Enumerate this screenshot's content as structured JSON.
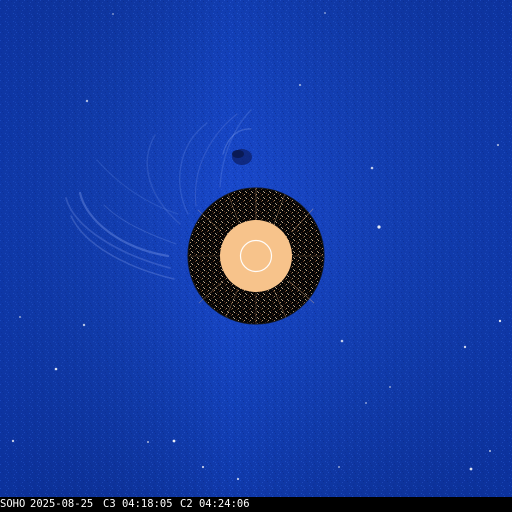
{
  "image": {
    "description_kind": "coronagraph composite",
    "colors": {
      "background_blue": "#123fb6",
      "background_dark": "#0a2f95",
      "occulter_black": "#050505",
      "inner_disk": "#f7c38b",
      "disk_outline": "#ffffff",
      "bar": "#000000",
      "text": "#ffffff"
    }
  },
  "caption": {
    "observatory": "SOHO",
    "date": "2025-08-25",
    "c3_time": "C3 04:18:05",
    "c2_time": "C2 04:24:06"
  }
}
